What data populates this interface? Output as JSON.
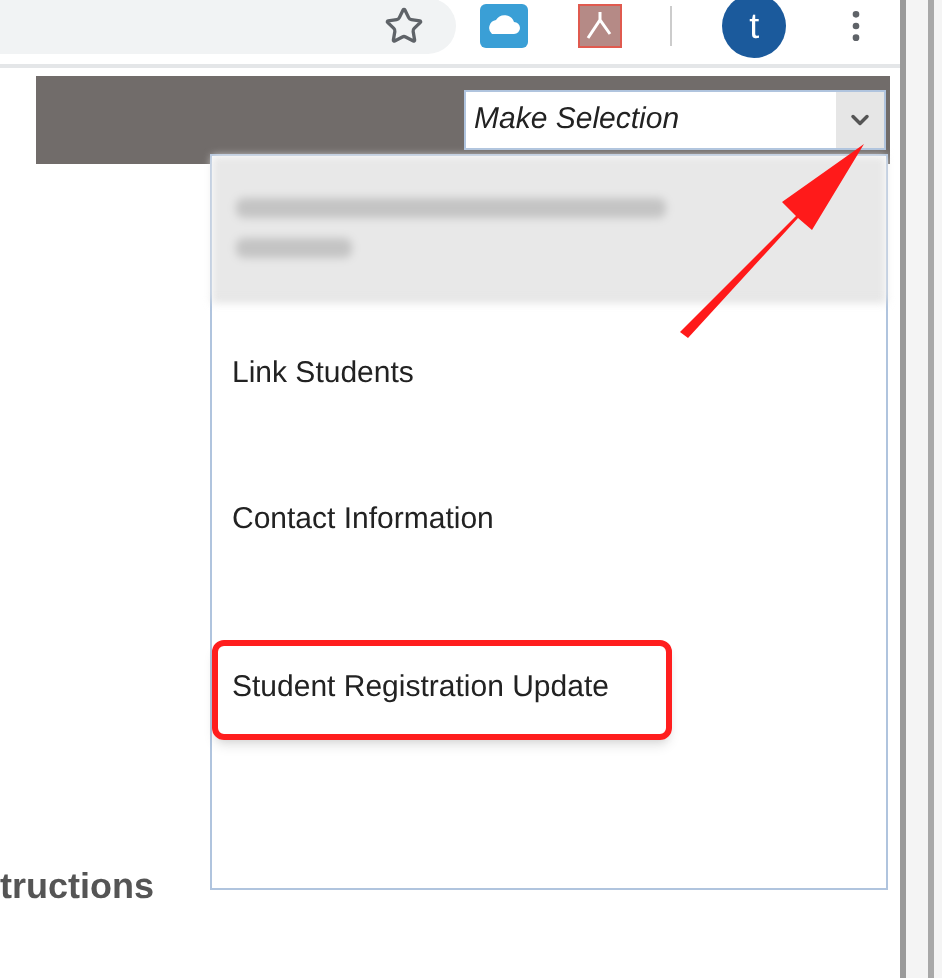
{
  "browser": {
    "avatar": "t"
  },
  "toolbar": {
    "select": {
      "value": "Make Selection",
      "expanded": true
    }
  },
  "menu": [
    {
      "kind": "redacted"
    },
    {
      "kind": "item",
      "label": "Link Students",
      "highlighted": false
    },
    {
      "kind": "item",
      "label": "Contact Information",
      "highlighted": false
    },
    {
      "kind": "item",
      "label": "Student Registration Update",
      "highlighted": true
    }
  ],
  "page": {
    "heading": "tructions"
  }
}
